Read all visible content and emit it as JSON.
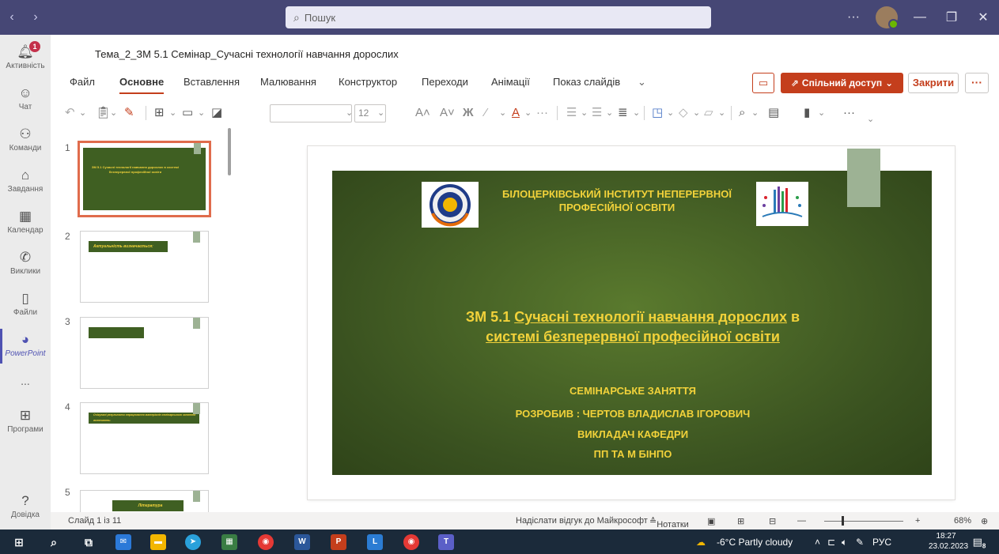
{
  "search": {
    "placeholder": "Пошук"
  },
  "rail": [
    {
      "label": "Активність",
      "badge": "1"
    },
    {
      "label": "Чат"
    },
    {
      "label": "Команди"
    },
    {
      "label": "Завдання"
    },
    {
      "label": "Календар"
    },
    {
      "label": "Виклики"
    },
    {
      "label": "Файли"
    },
    {
      "label": "PowerPoint"
    },
    {
      "label": "..."
    },
    {
      "label": "Програми"
    },
    {
      "label": "Довідка"
    }
  ],
  "document": {
    "title": "Тема_2_ЗМ 5.1 Семінар_Сучасні технології навчання дорослих"
  },
  "menus": [
    "Файл",
    "Основне",
    "Вставлення",
    "Малювання",
    "Конструктор",
    "Переходи",
    "Анімації",
    "Показ слайдів"
  ],
  "actions": {
    "share": "Спільний доступ",
    "close": "Закрити",
    "more": "···"
  },
  "toolbar": {
    "font_size": "12"
  },
  "thumbnails": [
    {
      "num": "1",
      "title": "ЗМ 5.1 Сучасні технології навчання дорослих в системі безперервної професійної освіти"
    },
    {
      "num": "2",
      "title": "Актуальність визначається:"
    },
    {
      "num": "3",
      "title": ""
    },
    {
      "num": "4",
      "title": "Очікувані результати опрацювання матеріалів семінарського заняття включають:"
    },
    {
      "num": "5",
      "title": "Література"
    }
  ],
  "slide": {
    "institution_line1": "БІЛОЦЕРКІВСЬКИЙ ІНСТИТУТ НЕПЕРЕРВНОЇ",
    "institution_line2": "ПРОФЕСІЙНОЇ ОСВІТИ",
    "title_prefix": "ЗМ 5.1 ",
    "title_line1": "Сучасні технології навчання дорослих",
    "title_line1_suffix": " в",
    "title_line2": "системі безперервної професійної освіти",
    "line_seminar": "СЕМІНАРСЬКЕ ЗАНЯТТЯ",
    "line_author": "РОЗРОБИВ : ЧЕРТОВ ВЛАДИСЛАВ ІГОРОВИЧ",
    "line_position": "ВИКЛАДАЧ КАФЕДРИ",
    "line_dept": "ПП ТА М БІНПО"
  },
  "status": {
    "slide_counter": "Слайд 1 із 11",
    "feedback": "Надіслати відгук до Майкрософт",
    "notes": "Нотатки",
    "zoom": "68%"
  },
  "taskbar": {
    "weather": "-6°C  Partly cloudy",
    "lang": "РУС",
    "time": "18:27",
    "date": "23.02.2023",
    "notif": "8"
  },
  "colors": {
    "teams_header": "#464775",
    "accent_orange": "#c43e1c",
    "slide_green": "#435f22",
    "slide_text": "#f2d23a"
  }
}
